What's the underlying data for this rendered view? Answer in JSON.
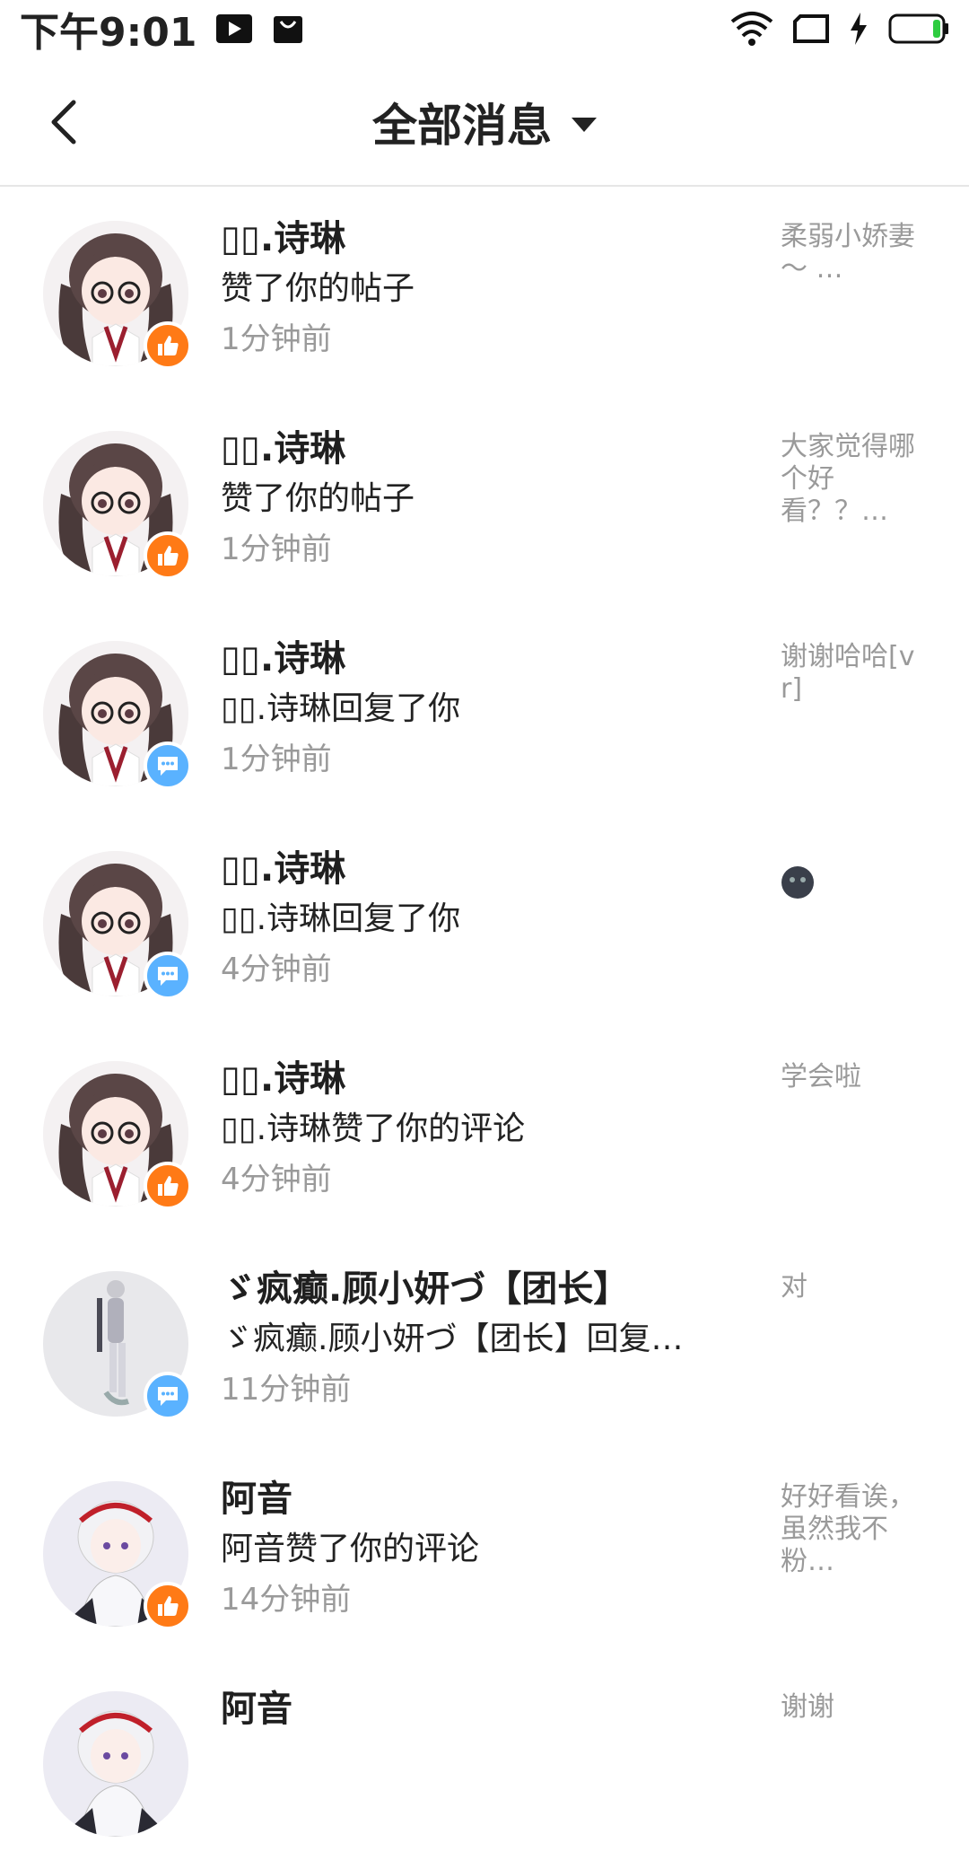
{
  "status_bar": {
    "time": "下午9:01",
    "left_icons": [
      "video-play-icon",
      "shopping-bag-icon"
    ],
    "right_icons": [
      "wifi-icon",
      "sim-card-icon",
      "charging-bolt-icon",
      "battery-icon"
    ],
    "battery_level": 0.15,
    "battery_color": "#2ecc40"
  },
  "header": {
    "title": "全部消息"
  },
  "messages": [
    {
      "name": "▯▯.诗琳",
      "desc": "赞了你的帖子",
      "time": "1分钟前",
      "preview": "柔弱小娇妻～ …",
      "badge": "like"
    },
    {
      "name": "▯▯.诗琳",
      "desc": "赞了你的帖子",
      "time": "1分钟前",
      "preview": "大家觉得哪个好看？？…",
      "badge": "like"
    },
    {
      "name": "▯▯.诗琳",
      "desc": "▯▯.诗琳回复了你",
      "time": "1分钟前",
      "preview": "谢谢哈哈[vr]",
      "badge": "reply"
    },
    {
      "name": "▯▯.诗琳",
      "desc": "▯▯.诗琳回复了你",
      "time": "4分钟前",
      "preview": "",
      "badge": "reply"
    },
    {
      "name": "▯▯.诗琳",
      "desc": "▯▯.诗琳赞了你的评论",
      "time": "4分钟前",
      "preview": "学会啦",
      "badge": "like"
    },
    {
      "name": "ゞ疯癫.顾小妍づ【团长】",
      "desc": "ゞ疯癫.顾小妍づ【团长】回复…",
      "time": "11分钟前",
      "preview": "对",
      "badge": "reply"
    },
    {
      "name": "阿音",
      "desc": "阿音赞了你的评论",
      "time": "14分钟前",
      "preview": "好好看诶，虽然我不粉…",
      "badge": "like"
    },
    {
      "name": "阿音",
      "desc": "",
      "time": "",
      "preview": "谢谢",
      "badge": ""
    }
  ],
  "colors": {
    "like_badge": "#ff7a16",
    "reply_badge": "#5ab2ff",
    "secondary_text": "#9a9a9a"
  }
}
